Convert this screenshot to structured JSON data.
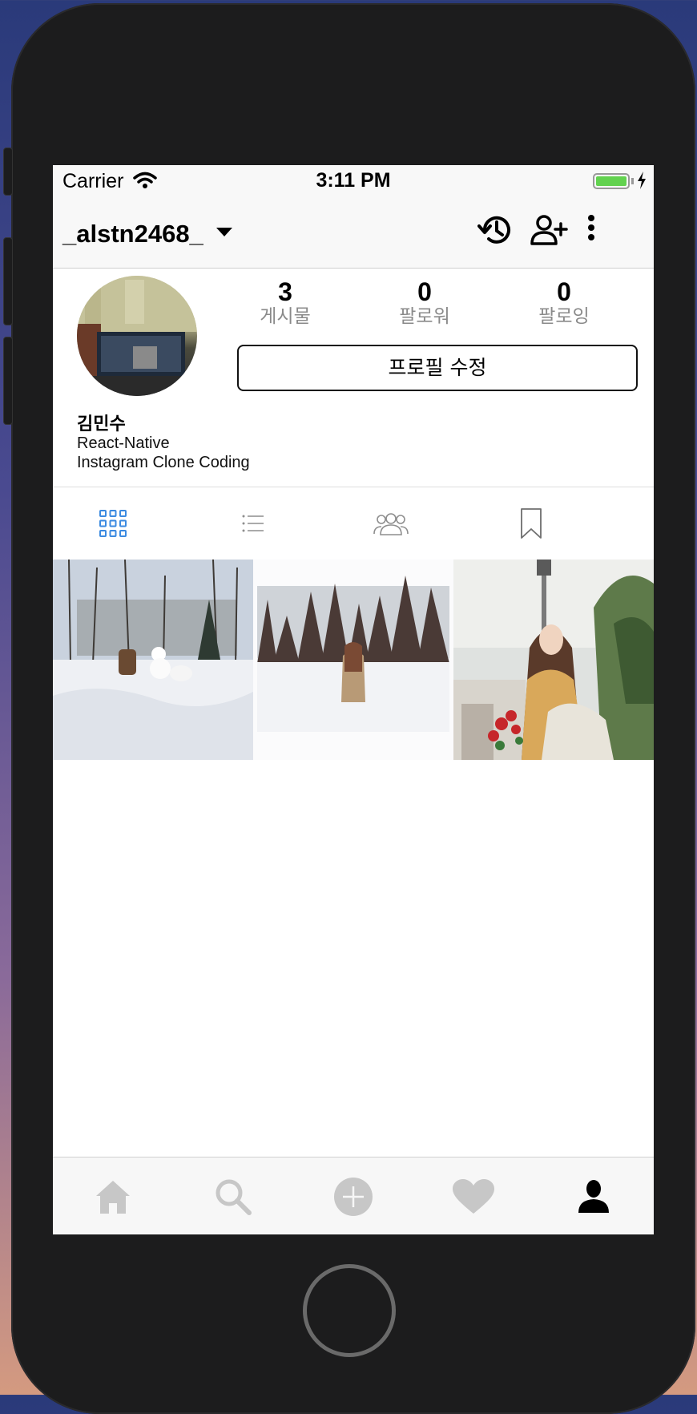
{
  "status_bar": {
    "carrier": "Carrier",
    "time": "3:11 PM"
  },
  "header": {
    "username": "_alstn2468_"
  },
  "profile": {
    "stats": [
      {
        "value": "3",
        "label": "게시물"
      },
      {
        "value": "0",
        "label": "팔로워"
      },
      {
        "value": "0",
        "label": "팔로잉"
      }
    ],
    "edit_button": "프로필 수정",
    "name": "김민수",
    "bio_line1": "React-Native",
    "bio_line2": "Instagram Clone Coding"
  },
  "tabs": [
    {
      "icon": "grid-icon",
      "active": true
    },
    {
      "icon": "list-icon",
      "active": false
    },
    {
      "icon": "tagged-people-icon",
      "active": false
    },
    {
      "icon": "bookmark-icon",
      "active": false
    }
  ],
  "photos": [
    {
      "subject": "snowy park with snowman"
    },
    {
      "subject": "snowy pine forest"
    },
    {
      "subject": "woman with tote bag"
    }
  ],
  "bottom_nav": [
    {
      "icon": "home-icon",
      "active": false
    },
    {
      "icon": "search-icon",
      "active": false
    },
    {
      "icon": "add-icon",
      "active": false
    },
    {
      "icon": "heart-icon",
      "active": false
    },
    {
      "icon": "profile-icon",
      "active": true
    }
  ],
  "colors": {
    "accent": "#3b8ae0",
    "inactive_icon": "#c7c7c7",
    "battery": "#62d24f"
  }
}
